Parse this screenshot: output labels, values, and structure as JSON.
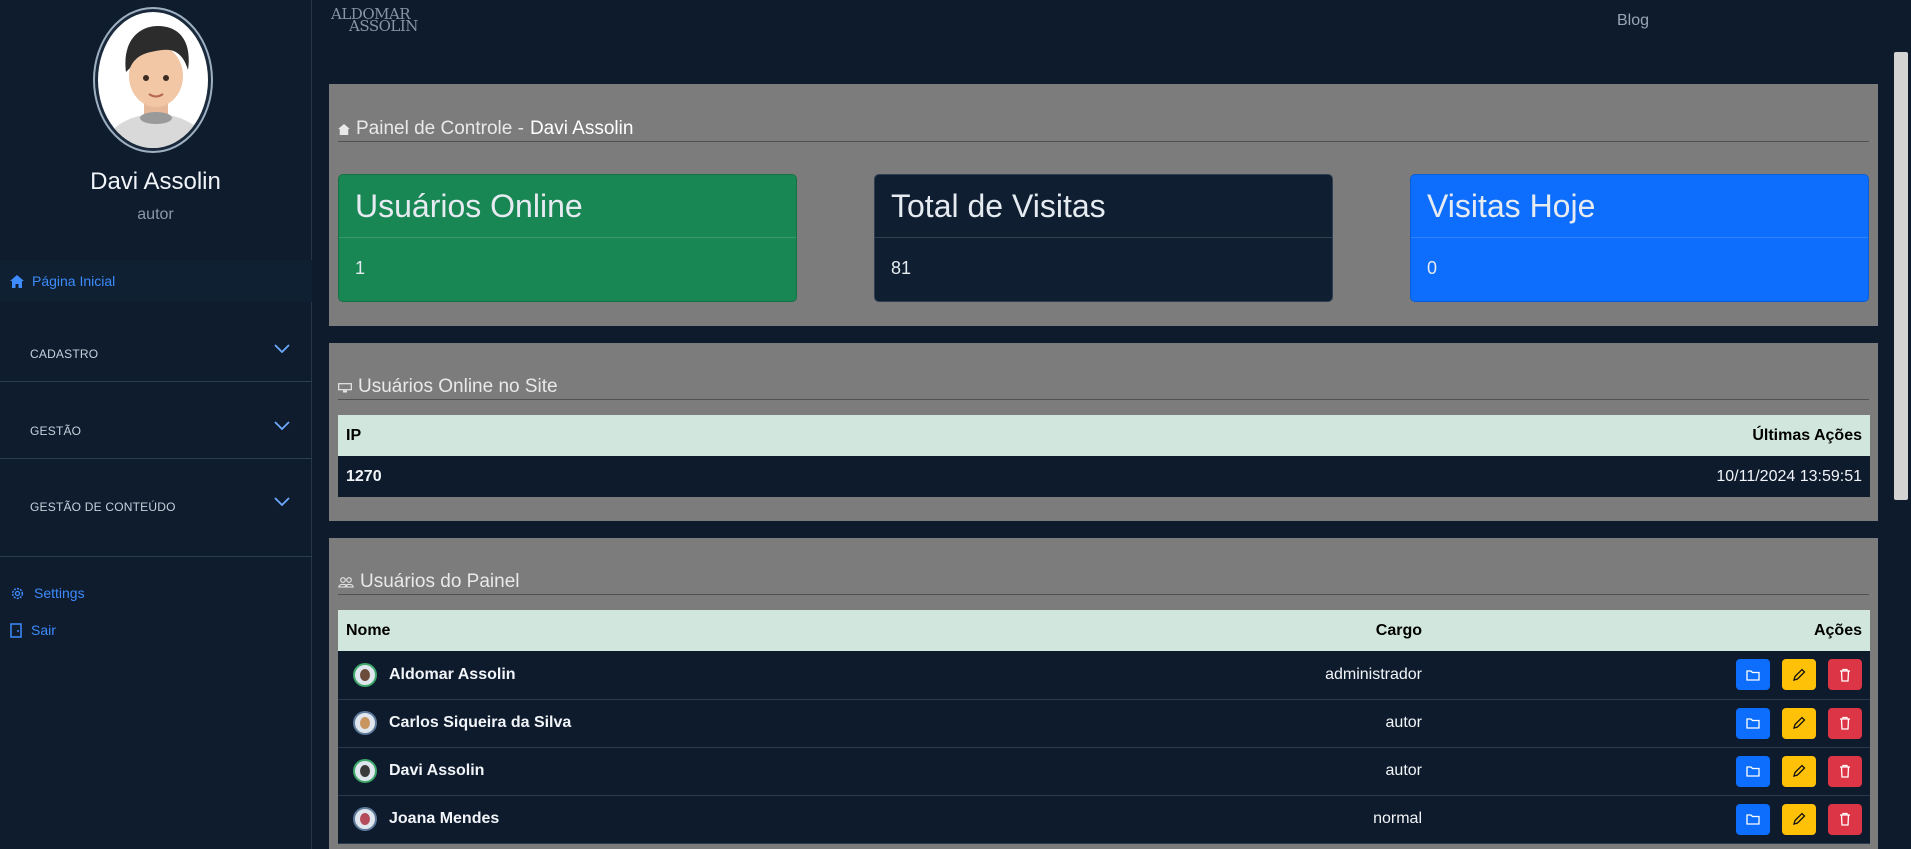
{
  "profile": {
    "name": "Davi Assolin",
    "role": "autor"
  },
  "nav": {
    "home": "Página Inicial",
    "groups": [
      "CADASTRO",
      "GESTÃO",
      "GESTÃO DE CONTEÚDO"
    ],
    "settings": "Settings",
    "logout": "Sair"
  },
  "topbar": {
    "logo_line1": "ALDOMAR",
    "logo_line2": "ASSOLIN",
    "blog": "Blog"
  },
  "dashboard": {
    "title_prefix": "Painel de Controle -",
    "title_user": "Davi Assolin",
    "cards": [
      {
        "label": "Usuários Online",
        "value": "1",
        "color": "#198754"
      },
      {
        "label": "Total de Visitas",
        "value": "81",
        "color": "#0f1f31"
      },
      {
        "label": "Visitas Hoje",
        "value": "0",
        "color": "#0d6efd"
      }
    ]
  },
  "online": {
    "title": "Usuários Online no Site",
    "headers": [
      "IP",
      "Últimas Ações"
    ],
    "rows": [
      {
        "ip": "1270",
        "last": "10/11/2024 13:59:51"
      }
    ]
  },
  "users": {
    "title": "Usuários do Painel",
    "headers": [
      "Nome",
      "Cargo",
      "Ações"
    ],
    "rows": [
      {
        "name": "Aldomar Assolin",
        "role": "administrador"
      },
      {
        "name": "Carlos Siqueira da Silva",
        "role": "autor"
      },
      {
        "name": "Davi Assolin",
        "role": "autor"
      },
      {
        "name": "Joana Mendes",
        "role": "normal"
      }
    ]
  }
}
